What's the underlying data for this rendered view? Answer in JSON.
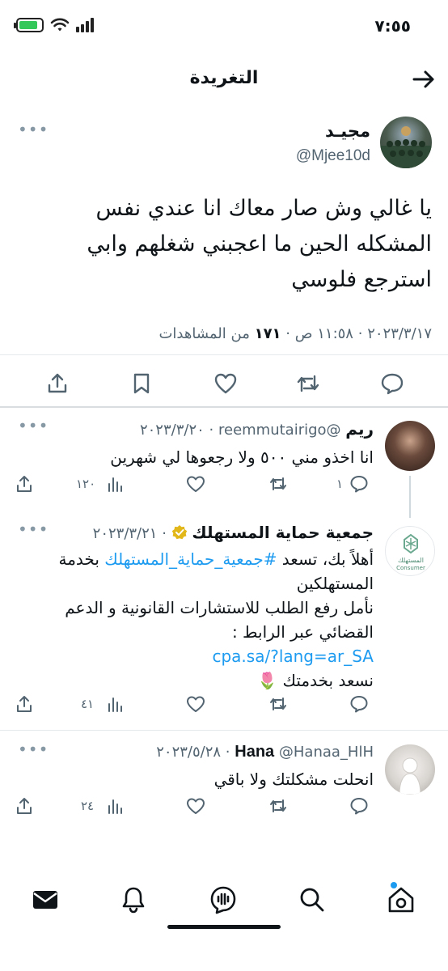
{
  "status": {
    "time": "٧:٥٥",
    "battery_level": 0.85
  },
  "header": {
    "title": "التغريدة"
  },
  "main_tweet": {
    "author_name": "مجيـد",
    "author_handle": "@Mjee10d",
    "text": "يا غالي وش صار معاك انا عندي نفس المشكله الحين ما اعجبني شغلهم وابي استرجع فلوسي",
    "date": "٢٠٢٣/٣/١٧",
    "time": "١١:٥٨ ص",
    "views_count": "١٧١",
    "views_label": "من المشاهدات"
  },
  "replies": [
    {
      "name": "ريم",
      "handle": "@reemmutairigo",
      "date": "٢٠٢٣/٣/٢٠",
      "text": "انا اخذو مني ٥٠٠ ولا رجعوها لي شهرين",
      "reply_count": "١",
      "views": "١٢٠"
    },
    {
      "name": "جمعية حماية المستهلك",
      "date": "٢٠٢٣/٣/٢١",
      "avatar_text": "المستهلك",
      "avatar_subtext": "Consumer",
      "text_line1_a": "أهلاً بك، تسعد ",
      "text_line1_hashtag": "#جمعية_حماية_المستهلك",
      "text_line1_b": " بخدمة المستهلكين",
      "text_line2": "نأمل رفع الطلب للاستشارات القانونية و الدعم القضائي عبر الرابط :",
      "link": "cpa.sa/?lang=ar_SA",
      "text_line3": "نسعد بخدمتك 🌷",
      "views": "٤١"
    },
    {
      "name": "Hana",
      "handle": "@Hanaa_HlH",
      "date": "٢٠٢٣/٥/٢٨",
      "text": "انحلت مشكلتك ولا باقي",
      "views": "٢٤"
    }
  ],
  "separator": "·",
  "more": "•••",
  "icons": {
    "back": "arrow-right-icon",
    "reply": "chat-bubble-icon",
    "retweet": "retweet-icon",
    "like": "heart-icon",
    "bookmark": "bookmark-icon",
    "share": "share-icon",
    "views": "bar-chart-icon"
  },
  "colors": {
    "accent": "#1d9bf0",
    "verified": "#e2b719",
    "muted": "#536471"
  }
}
